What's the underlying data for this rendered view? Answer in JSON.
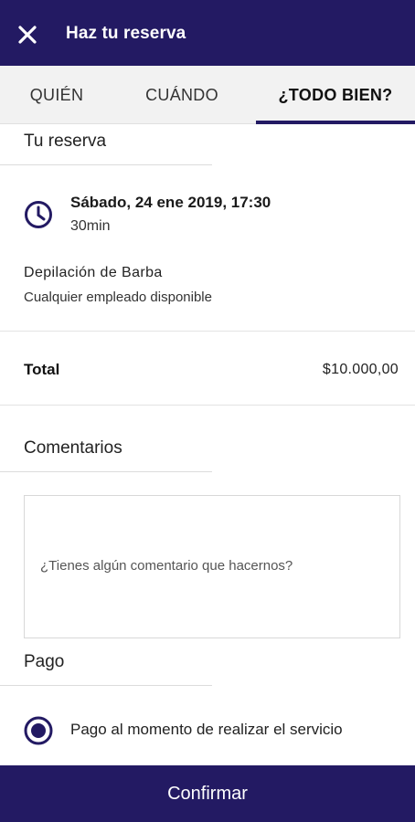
{
  "appbar": {
    "title": "Haz tu reserva",
    "close_icon": "close-icon",
    "background": "#231a63"
  },
  "tabs": [
    {
      "label": "QUIÉN",
      "active": false
    },
    {
      "label": "CUÁNDO",
      "active": false
    },
    {
      "label": "¿TODO BIEN?",
      "active": true
    }
  ],
  "reservation": {
    "heading": "Tu reserva",
    "datetime": "Sábado, 24 ene 2019, 17:30",
    "duration": "30min",
    "service": "Depilación de Barba",
    "employee": "Cualquier empleado disponible"
  },
  "total": {
    "label": "Total",
    "value": "$10.000,00"
  },
  "comments": {
    "heading": "Comentarios",
    "placeholder": "¿Tienes algún comentario que hacernos?",
    "value": ""
  },
  "payment": {
    "heading": "Pago",
    "option_label": "Pago al momento de realizar el servicio",
    "selected": true
  },
  "footer": {
    "confirm_label": "Confirmar"
  },
  "colors": {
    "accent": "#231a63"
  }
}
